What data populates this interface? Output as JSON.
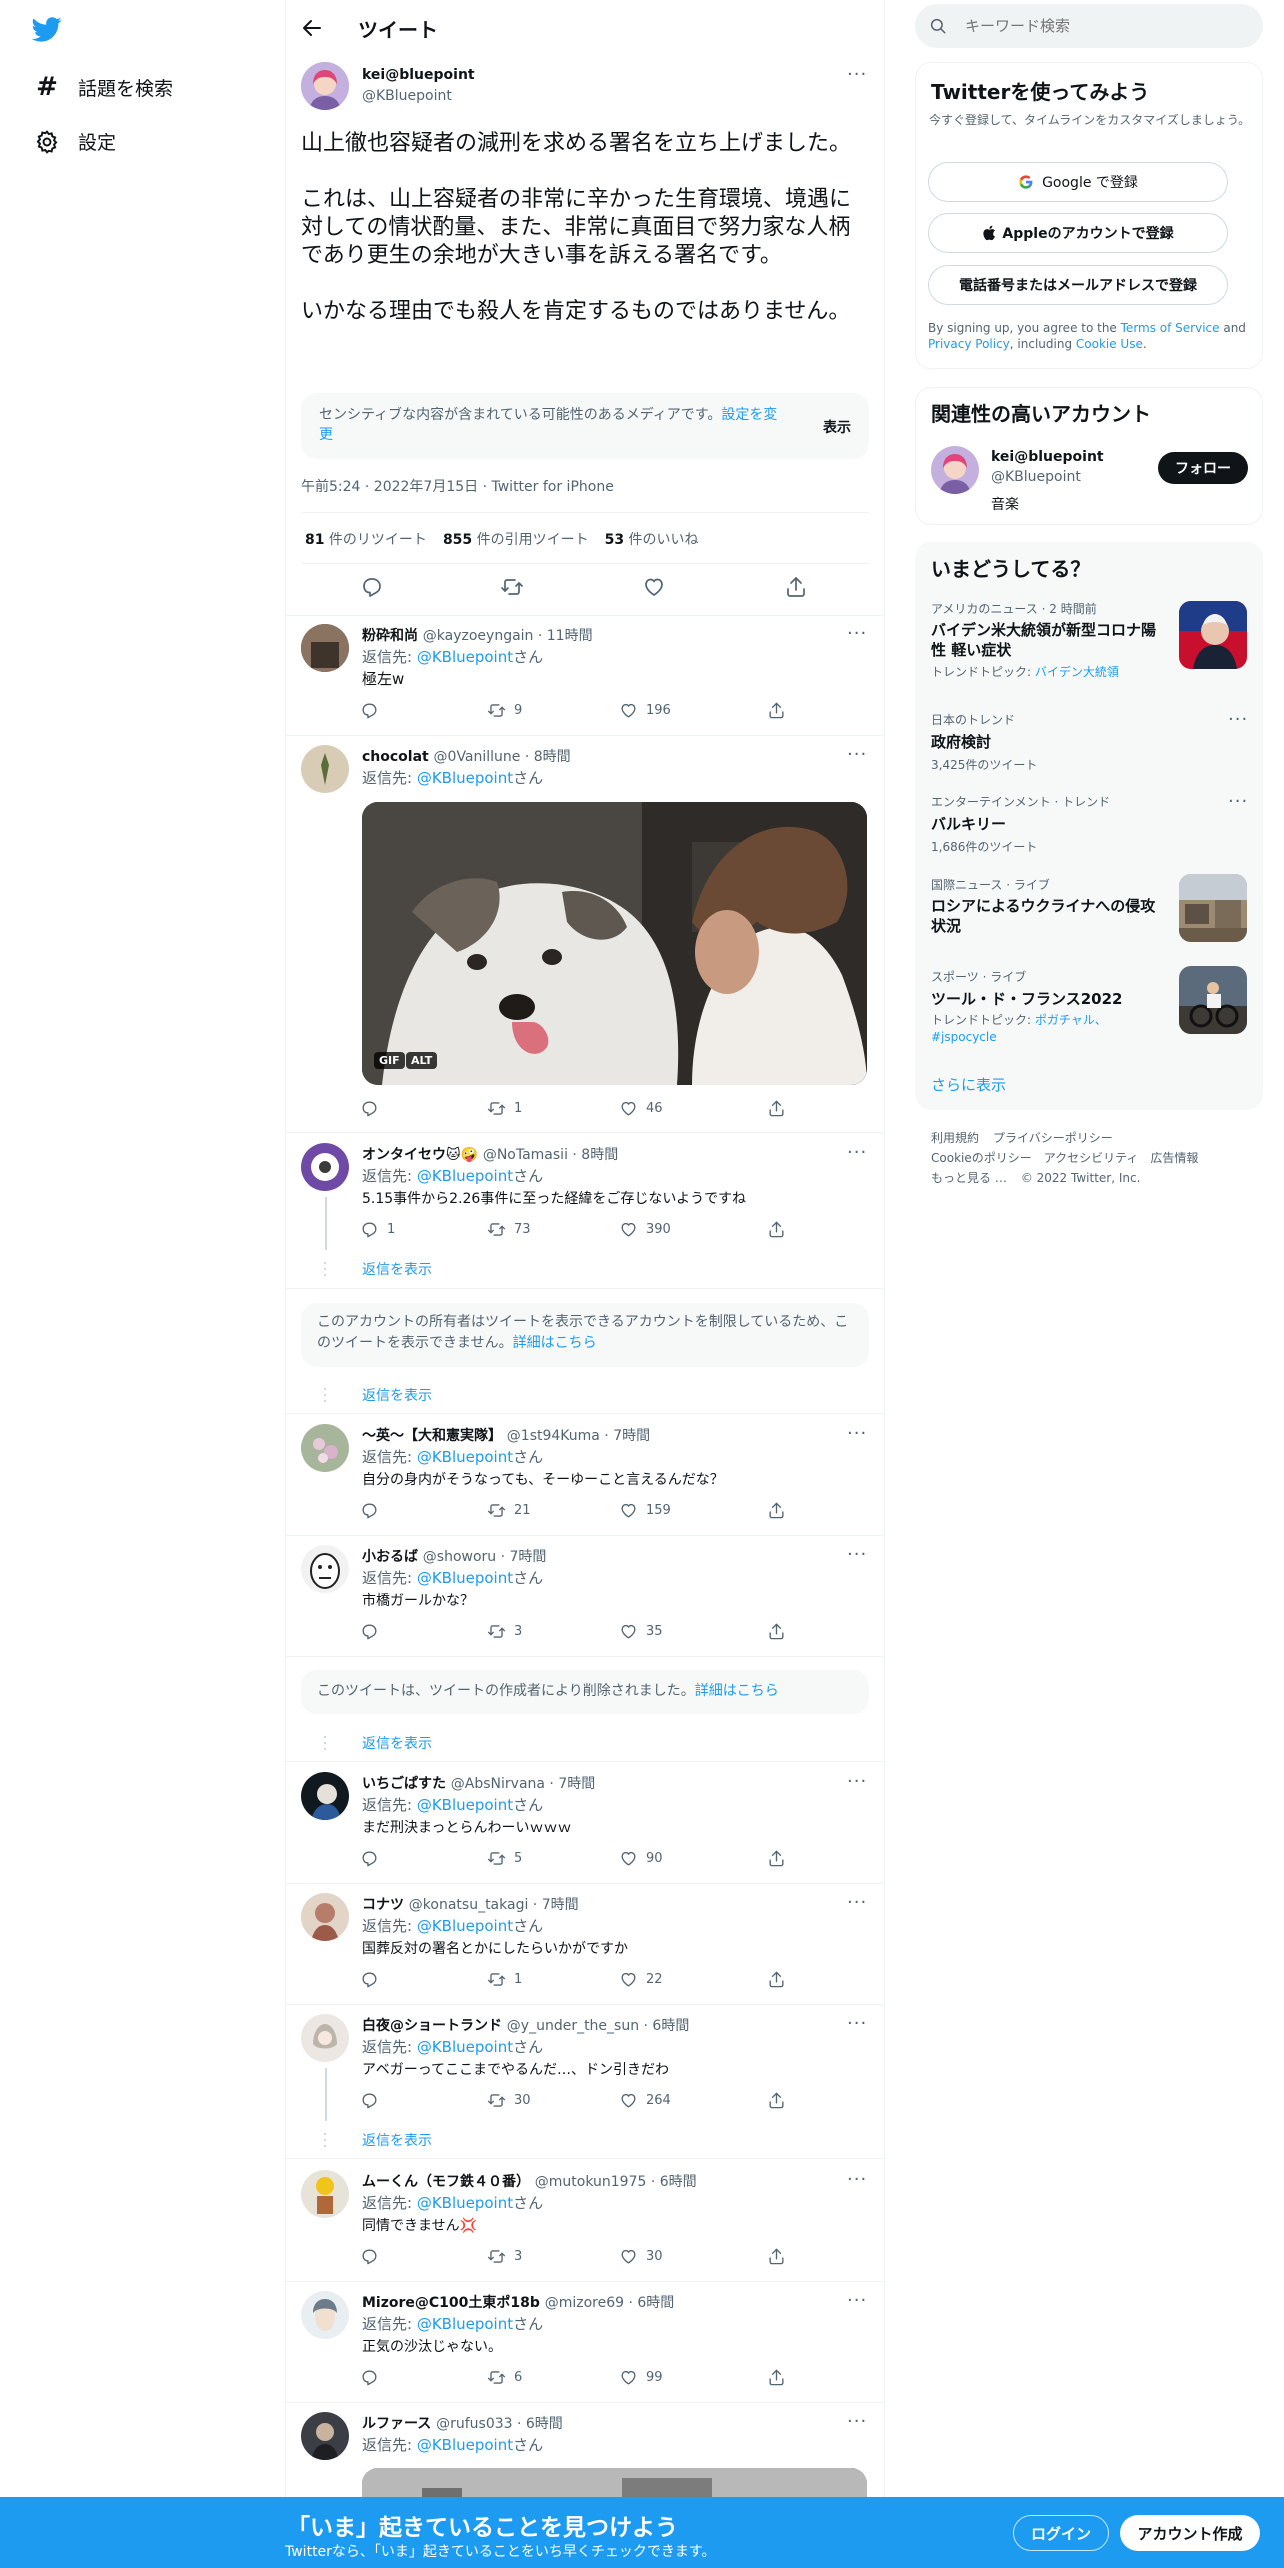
{
  "nav": {
    "explore": "話題を検索",
    "settings": "設定"
  },
  "header": {
    "title": "ツイート"
  },
  "tweet": {
    "name": "kei@bluepoint",
    "handle": "@KBluepoint",
    "p1": "山上徹也容疑者の減刑を求める署名を立ち上げました。",
    "p2": "これは、山上容疑者の非常に辛かった生育環境、境遇に対しての情状酌量、また、非常に真面目で努力家な人柄であり更生の余地が大きい事を訴える署名です。",
    "p3": "いかなる理由でも殺人を肯定するものではありません。",
    "sensitive": "センシティブな内容が含まれている可能性のあるメディアです。",
    "sensitive_link": "設定を変更",
    "show": "表示",
    "time": "午前5:24 · 2022年7月15日 · Twitter for iPhone",
    "rt_count": "81",
    "rt_label": " 件のリツイート",
    "qt_count": "855",
    "qt_label": " 件の引用ツイート",
    "like_count": "53",
    "like_label": " 件のいいね"
  },
  "replying": {
    "prefix": "返信先: ",
    "to": "@KBluepoint",
    "suffix": "さん"
  },
  "show_replies": "返信を表示",
  "replies": [
    {
      "name": "粉砕和尚",
      "meta": "@kayzoeyngain · 11時間",
      "text": "極左w",
      "rt": "9",
      "like": "196"
    },
    {
      "name": "chocolat",
      "meta": "@0Vanillune · 8時間",
      "text": "",
      "rt": "1",
      "like": "46",
      "gif": "GIF",
      "alt": "ALT"
    },
    {
      "name": "オンタイセウ🐱🤪",
      "meta": "@NoTamasii · 8時間",
      "text": "5.15事件から2.26事件に至った経緯をご存じないようですね",
      "reply": "1",
      "rt": "73",
      "like": "390"
    },
    {
      "name": "〜英〜【大和憲実隊】",
      "meta": "@1st94Kuma · 7時間",
      "text": "自分の身内がそうなっても、そーゆーこと言えるんだな？",
      "rt": "21",
      "like": "159"
    },
    {
      "name": "小おるば",
      "meta": "@showoru · 7時間",
      "text": "市橋ガールかな？",
      "rt": "3",
      "like": "35"
    },
    {
      "name": "いちごぱすた",
      "meta": "@AbsNirvana · 7時間",
      "text": "まだ刑決まっとらんわーいｗｗｗ",
      "rt": "5",
      "like": "90"
    },
    {
      "name": "コナツ",
      "meta": "@konatsu_takagi · 7時間",
      "text": "国葬反対の署名とかにしたらいかがですか",
      "rt": "1",
      "like": "22"
    },
    {
      "name": "白夜@ショートランド",
      "meta": "@y_under_the_sun · 6時間",
      "text": "アベガーってここまでやるんだ…、ドン引きだわ",
      "rt": "30",
      "like": "264"
    },
    {
      "name": "ムーくん（モフ鉄４０番）",
      "meta": "@mutokun1975 · 6時間",
      "text": "同情できません💢",
      "rt": "3",
      "like": "30"
    },
    {
      "name": "Mizore@C100土東ポ18b",
      "meta": "@mizore69 · 6時間",
      "text": "正気の沙汰じゃない。",
      "rt": "6",
      "like": "99"
    },
    {
      "name": "ルファース",
      "meta": "@rufus033 · 6時間",
      "text": ""
    }
  ],
  "notice1": {
    "text": "このアカウントの所有者はツイートを表示できるアカウントを制限しているため、このツイートを表示できません。",
    "link": "詳細はこちら"
  },
  "notice2": {
    "text": "このツイートは、ツイートの作成者により削除されました。",
    "link": "詳細はこちら"
  },
  "search": {
    "placeholder": "キーワード検索"
  },
  "signup": {
    "title": "Twitterを使ってみよう",
    "sub": "今すぐ登録して、タイムラインをカスタマイズしましょう。",
    "google": "Google で登録",
    "apple": "Appleのアカウントで登録",
    "phone": "電話番号またはメールアドレスで登録",
    "legal1": "By signing up, you agree to the ",
    "tos": "Terms of Service",
    "and": " and ",
    "privacy": "Privacy Policy",
    "incl": ", including ",
    "cookie": "Cookie Use",
    "dot": "."
  },
  "related": {
    "title": "関連性の高いアカウント",
    "name": "kei@bluepoint",
    "handle": "@KBluepoint",
    "bio": "音楽",
    "follow": "フォロー"
  },
  "trends": {
    "title": "いまどうしてる？",
    "items": [
      {
        "cat": "アメリカのニュース · 2 時間前",
        "title": "バイデン米大統領が新型コロナ陽性 軽い症状",
        "sub_prefix": "トレンドトピック: ",
        "sub_link": "バイデン大統領"
      },
      {
        "cat": "日本のトレンド",
        "title": "政府検討",
        "sub": "3,425件のツイート"
      },
      {
        "cat": "エンターテインメント · トレンド",
        "title": "バルキリー",
        "sub": "1,686件のツイート"
      },
      {
        "cat": "国際ニュース · ライブ",
        "title": "ロシアによるウクライナへの侵攻状況"
      },
      {
        "cat": "スポーツ · ライブ",
        "title": "ツール・ド・フランス2022",
        "sub_prefix": "トレンドトピック: ",
        "sub_link": "ポガチャル、#jspocycle"
      }
    ],
    "more": "さらに表示"
  },
  "footer": {
    "l1": "利用規約",
    "l2": "プライバシーポリシー",
    "l3": "Cookieのポリシー",
    "l4": "アクセシビリティ",
    "l5": "広告情報",
    "l6": "もっと見る …",
    "copy": "© 2022 Twitter, Inc."
  },
  "banner": {
    "title": "「いま」起きていることを見つけよう",
    "sub": "Twitterなら、「いま」起きていることをいち早くチェックできます。",
    "login": "ログイン",
    "signup": "アカウント作成"
  },
  "colors": {
    "accent": "#1d9bf0",
    "banner": "#1d9bf0",
    "text": "#0f1419",
    "secondary": "#536471"
  }
}
